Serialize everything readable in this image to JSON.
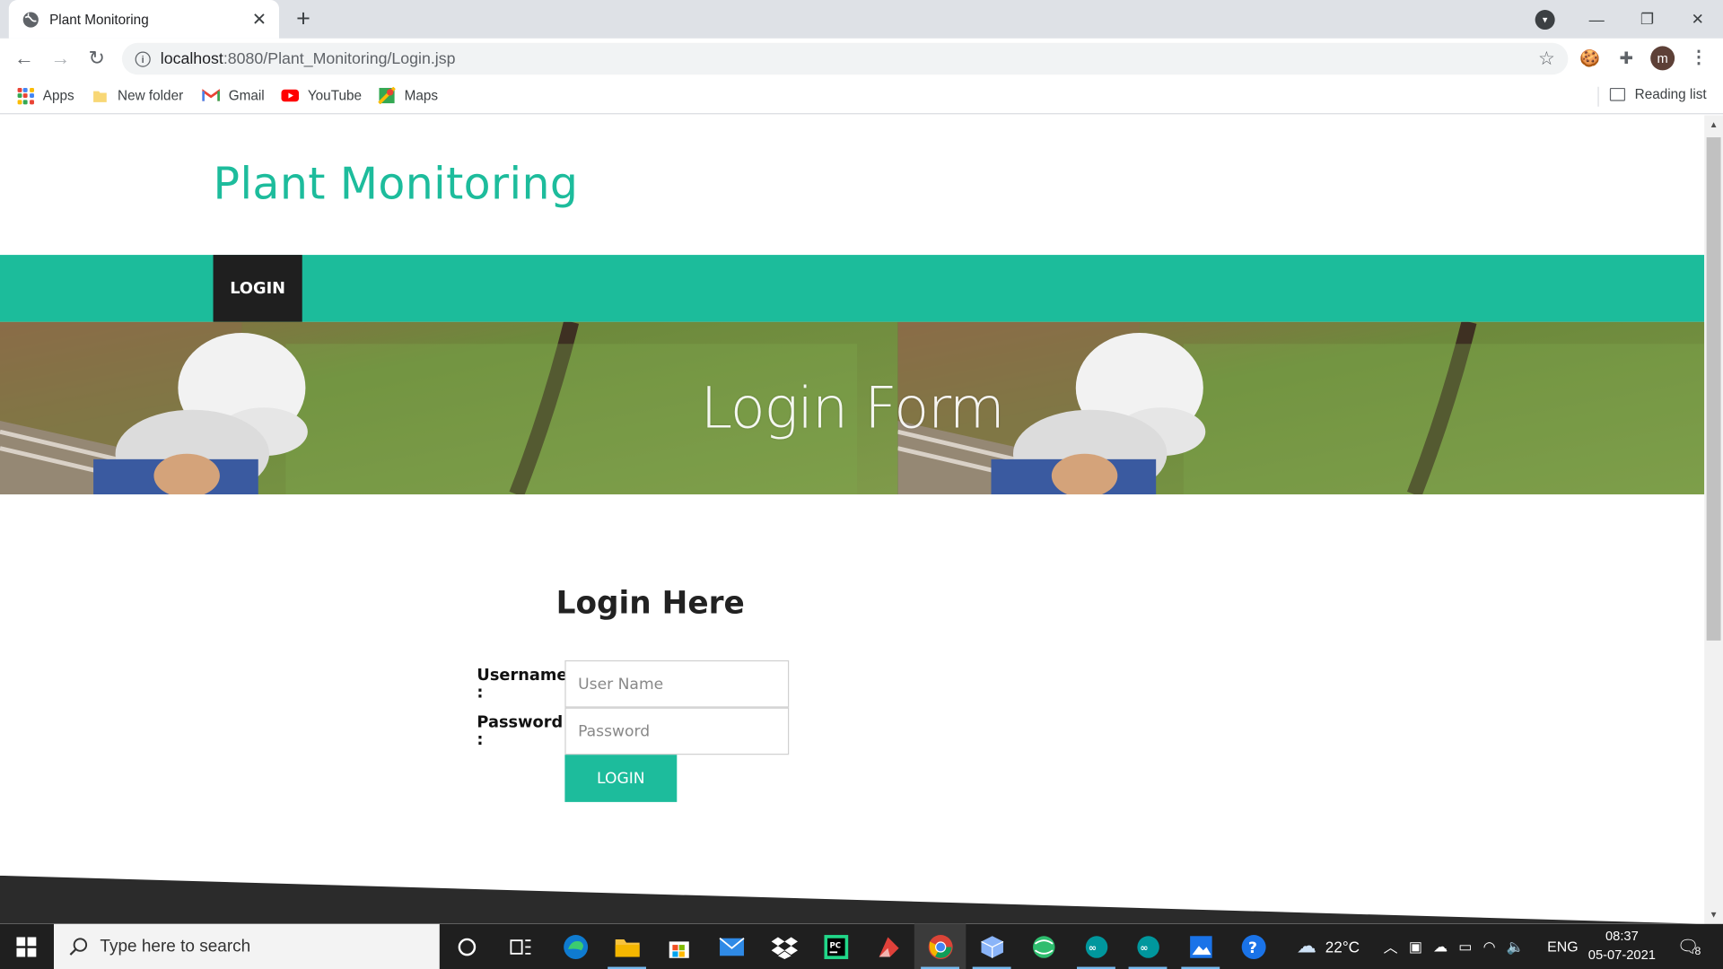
{
  "browser": {
    "tab_title": "Plant Monitoring",
    "url_host": "localhost",
    "url_path": ":8080/Plant_Monitoring/Login.jsp",
    "avatar_letter": "m",
    "bookmarks": [
      {
        "label": "Apps",
        "icon": "apps-grid-icon"
      },
      {
        "label": "New folder",
        "icon": "folder-icon"
      },
      {
        "label": "Gmail",
        "icon": "gmail-icon"
      },
      {
        "label": "YouTube",
        "icon": "youtube-icon"
      },
      {
        "label": "Maps",
        "icon": "maps-icon"
      }
    ],
    "reading_list": "Reading list"
  },
  "site": {
    "title": "Plant Monitoring",
    "nav_login": "LOGIN",
    "banner_title": "Login Form",
    "heading": "Login Here",
    "username_label": "Username :",
    "username_placeholder": "User Name",
    "password_label": "Password :",
    "password_placeholder": "Password",
    "login_button": "LOGIN",
    "accent_color": "#1dbc9c"
  },
  "taskbar": {
    "search_placeholder": "Type here to search",
    "weather": "22°C",
    "language": "ENG",
    "time": "08:37",
    "date": "05-07-2021",
    "notifications": "8"
  }
}
